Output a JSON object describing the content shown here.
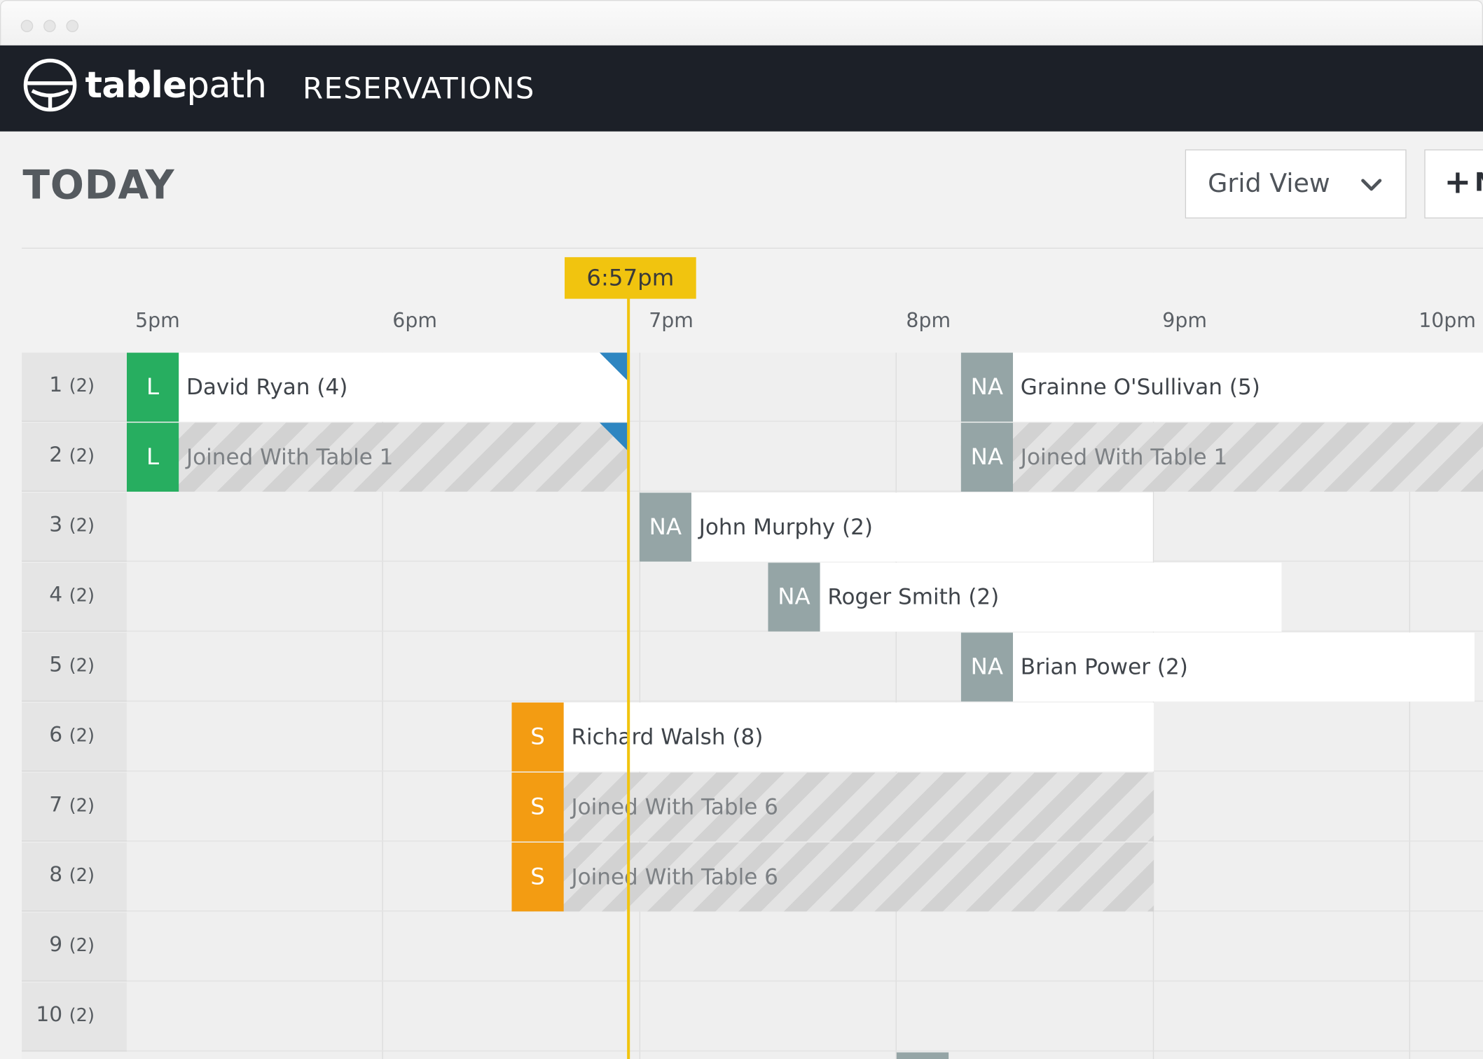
{
  "app": {
    "brand_bold": "table",
    "brand_light": "path",
    "nav_item": "RESERVATIONS"
  },
  "page": {
    "title": "TODAY"
  },
  "controls": {
    "view_select": "Grid View",
    "new_button_icon": "+",
    "new_button_label": "N"
  },
  "timeline": {
    "hours": [
      "5pm",
      "6pm",
      "7pm",
      "8pm",
      "9pm",
      "10pm"
    ],
    "current_time": "6:57pm"
  },
  "tables": [
    {
      "number": "1",
      "capacity": "(2)"
    },
    {
      "number": "2",
      "capacity": "(2)"
    },
    {
      "number": "3",
      "capacity": "(2)"
    },
    {
      "number": "4",
      "capacity": "(2)"
    },
    {
      "number": "5",
      "capacity": "(2)"
    },
    {
      "number": "6",
      "capacity": "(2)"
    },
    {
      "number": "7",
      "capacity": "(2)"
    },
    {
      "number": "8",
      "capacity": "(2)"
    },
    {
      "number": "9",
      "capacity": "(2)"
    },
    {
      "number": "10",
      "capacity": "(2)"
    }
  ],
  "reservations": [
    {
      "table": "1",
      "status": "L",
      "name": "David Ryan (4)",
      "start": "5:00pm"
    },
    {
      "table": "1",
      "status": "NA",
      "name": "Grainne O'Sullivan (5)",
      "start": "8:15pm"
    },
    {
      "table": "2",
      "status": "L",
      "name": "Joined With Table 1",
      "start": "5:00pm"
    },
    {
      "table": "2",
      "status": "NA",
      "name": "Joined With Table 1",
      "start": "8:15pm"
    },
    {
      "table": "3",
      "status": "NA",
      "name": "John Murphy (2)",
      "start": "7:00pm"
    },
    {
      "table": "4",
      "status": "NA",
      "name": "Roger Smith (2)",
      "start": "7:30pm"
    },
    {
      "table": "5",
      "status": "NA",
      "name": "Brian Power (2)",
      "start": "8:15pm"
    },
    {
      "table": "6",
      "status": "S",
      "name": "Richard Walsh (8)",
      "start": "6:30pm"
    },
    {
      "table": "7",
      "status": "S",
      "name": "Joined With Table 6",
      "start": "6:30pm"
    },
    {
      "table": "8",
      "status": "S",
      "name": "Joined With Table 6",
      "start": "6:30pm"
    }
  ],
  "colors": {
    "nav_bg": "#1c2028",
    "status_L": "#27ae60",
    "status_NA": "#95a5a6",
    "status_S": "#f39c12",
    "now_marker": "#f1c40f",
    "flag": "#2e86c1"
  }
}
